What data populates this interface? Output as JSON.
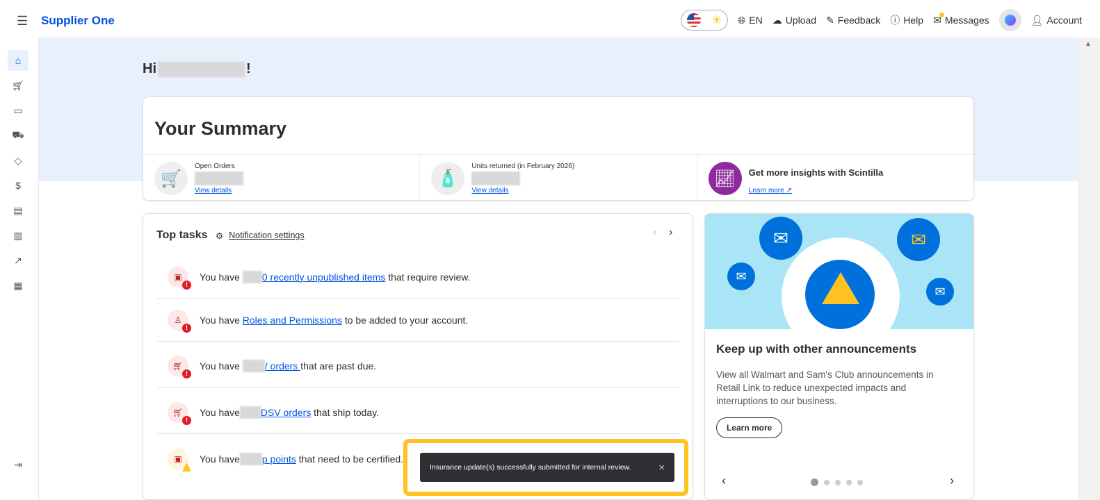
{
  "header": {
    "brand": "Supplier One",
    "lang": "EN",
    "upload": "Upload",
    "feedback": "Feedback",
    "help": "Help",
    "messages": "Messages",
    "account": "Account"
  },
  "greeting": {
    "prefix": "Hi",
    "suffix": "!"
  },
  "summary": {
    "title": "Your Summary",
    "open_orders": {
      "label": "Open Orders",
      "link": "View details"
    },
    "units_returned": {
      "label": "Units returned (in February 2026)",
      "link": "View details"
    },
    "scintilla": {
      "title": "Get more insights with Scintilla",
      "link": "Learn more"
    }
  },
  "tasks": {
    "title": "Top tasks",
    "settings": "Notification settings",
    "items": [
      {
        "pre": "You have",
        "link": "0 recently unpublished items",
        "post": " that require review."
      },
      {
        "pre": "You have ",
        "link": "Roles and Permissions",
        "post": " to be added to your account."
      },
      {
        "pre": "You have",
        "link": "/ orders ",
        "post": "that are past due."
      },
      {
        "pre": "You have",
        "link": "DSV orders",
        "post": " that ship today."
      },
      {
        "pre": "You have",
        "link": "p points",
        "post": " that need to be certified."
      }
    ]
  },
  "announcement": {
    "title": "Keep up with other announcements",
    "body": "View all Walmart and Sam's Club announcements in Retail Link to reduce unexpected impacts and interruptions to our business.",
    "button": "Learn more",
    "slides": 5,
    "active_slide": 1
  },
  "toast": {
    "message": "Insurance update(s) successfully submitted for internal review.",
    "close": "×"
  }
}
